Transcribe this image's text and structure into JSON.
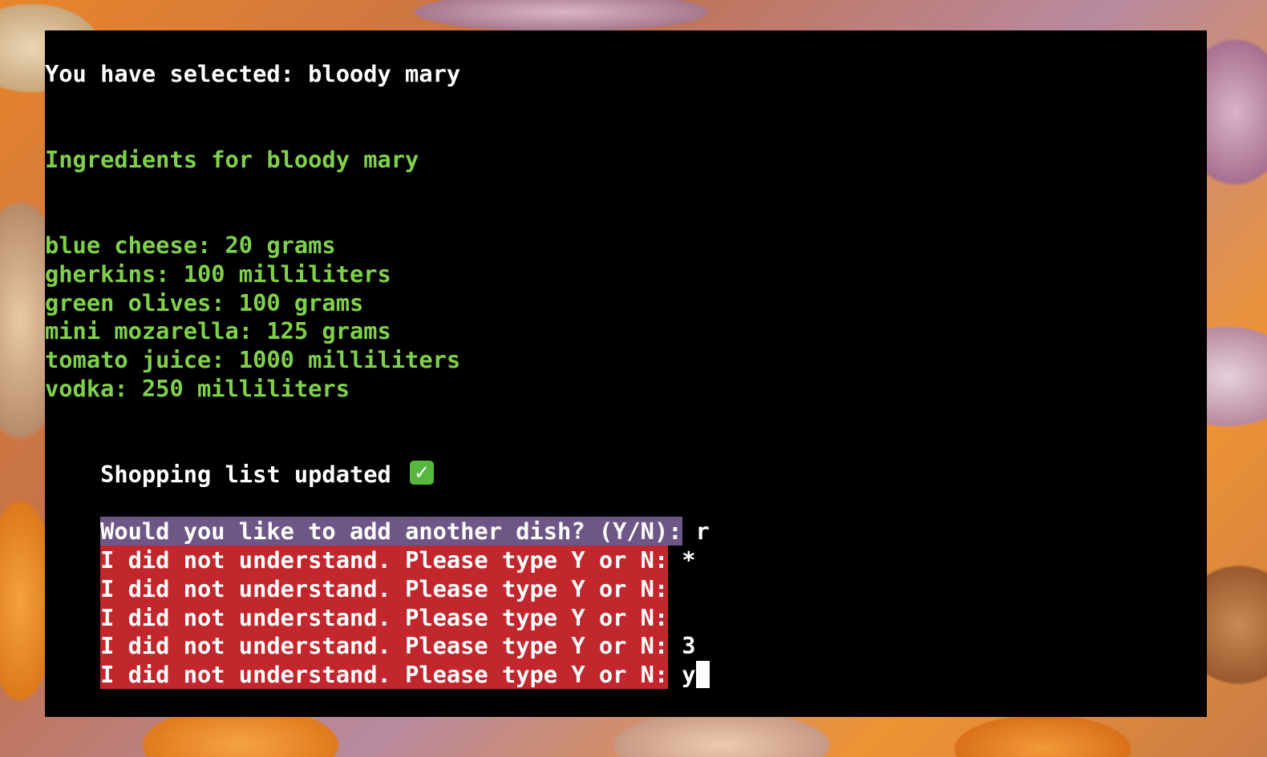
{
  "terminal": {
    "selected_line": "You have selected: bloody mary",
    "ingredients_heading": "Ingredients for bloody mary",
    "ingredients": [
      "blue cheese: 20 grams",
      "gherkins: 100 milliliters",
      "green olives: 100 grams",
      "mini mozarella: 125 grams",
      "tomato juice: 1000 milliliters",
      "vodka: 250 milliliters"
    ],
    "status_line": "Shopping list updated",
    "status_icon": "check-mark-icon",
    "question_prompt": "Would you like to add another dish? (Y/N):",
    "question_answer": "r",
    "retry_prompts": [
      {
        "prompt": "I did not understand. Please type Y or N:",
        "answer": "*"
      },
      {
        "prompt": "I did not understand. Please type Y or N:",
        "answer": ""
      },
      {
        "prompt": "I did not understand. Please type Y or N:",
        "answer": ""
      },
      {
        "prompt": "I did not understand. Please type Y or N:",
        "answer": "3"
      },
      {
        "prompt": "I did not understand. Please type Y or N:",
        "answer": "y"
      }
    ]
  },
  "colors": {
    "terminal_bg": "#000000",
    "text_white": "#ffffff",
    "text_green": "#7fd14b",
    "prompt_purple": "#6e5786",
    "prompt_red": "#c1272d",
    "check_green": "#56b83f"
  }
}
